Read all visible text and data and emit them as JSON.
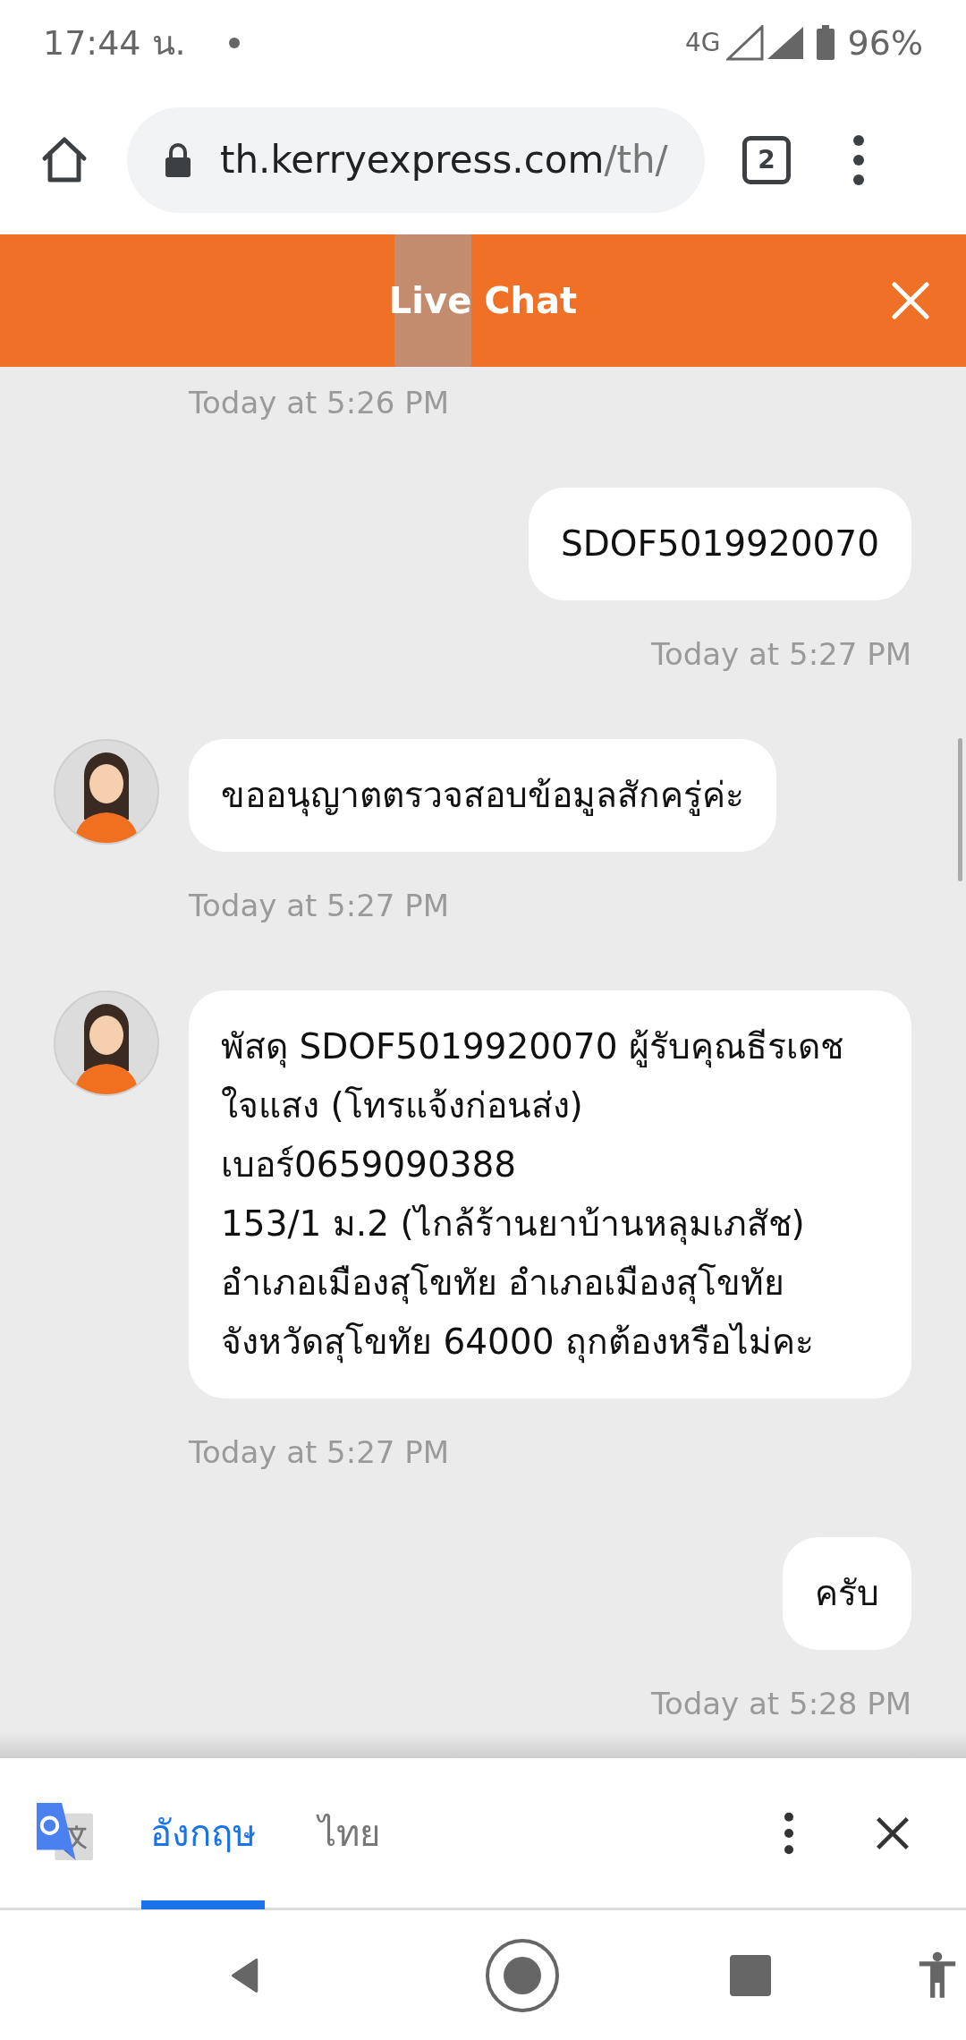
{
  "status_bar": {
    "time": "17:44 น.",
    "network": "4G",
    "battery": "96%"
  },
  "browser": {
    "url_host": "th.kerryexpress.com",
    "url_path": "/th/",
    "tab_count": "2"
  },
  "header": {
    "title": "Live Chat"
  },
  "chat": [
    {
      "kind": "received_time",
      "text": "Today at 5:26 PM"
    },
    {
      "kind": "sent",
      "text": "SDOF5019920070"
    },
    {
      "kind": "sent_time",
      "text": "Today at 5:27 PM"
    },
    {
      "kind": "received",
      "text": "ขออนุญาตตรวจสอบข้อมูลสักครู่ค่ะ"
    },
    {
      "kind": "received_time",
      "text": "Today at 5:27 PM"
    },
    {
      "kind": "received",
      "text": "พัสดุ SDOF5019920070 ผู้รับคุณธีรเดช ใจแสง (โทรแจ้งก่อนส่ง)\nเบอร์0659090388\n153/1 ม.2 (ไกล้ร้านยาบ้านหลุมเภสัช)\nอำเภอเมืองสุโขทัย อำเภอเมืองสุโขทัย\nจังหวัดสุโขทัย 64000 ถุกต้องหรือไม่คะ"
    },
    {
      "kind": "received_time",
      "text": "Today at 5:27 PM"
    },
    {
      "kind": "sent",
      "text": "ครับ"
    },
    {
      "kind": "sent_time",
      "text": "Today at 5:28 PM"
    }
  ],
  "translate_bar": {
    "tabs": [
      {
        "label": "อังกฤษ",
        "selected": true
      },
      {
        "label": "ไทย",
        "selected": false
      }
    ]
  }
}
